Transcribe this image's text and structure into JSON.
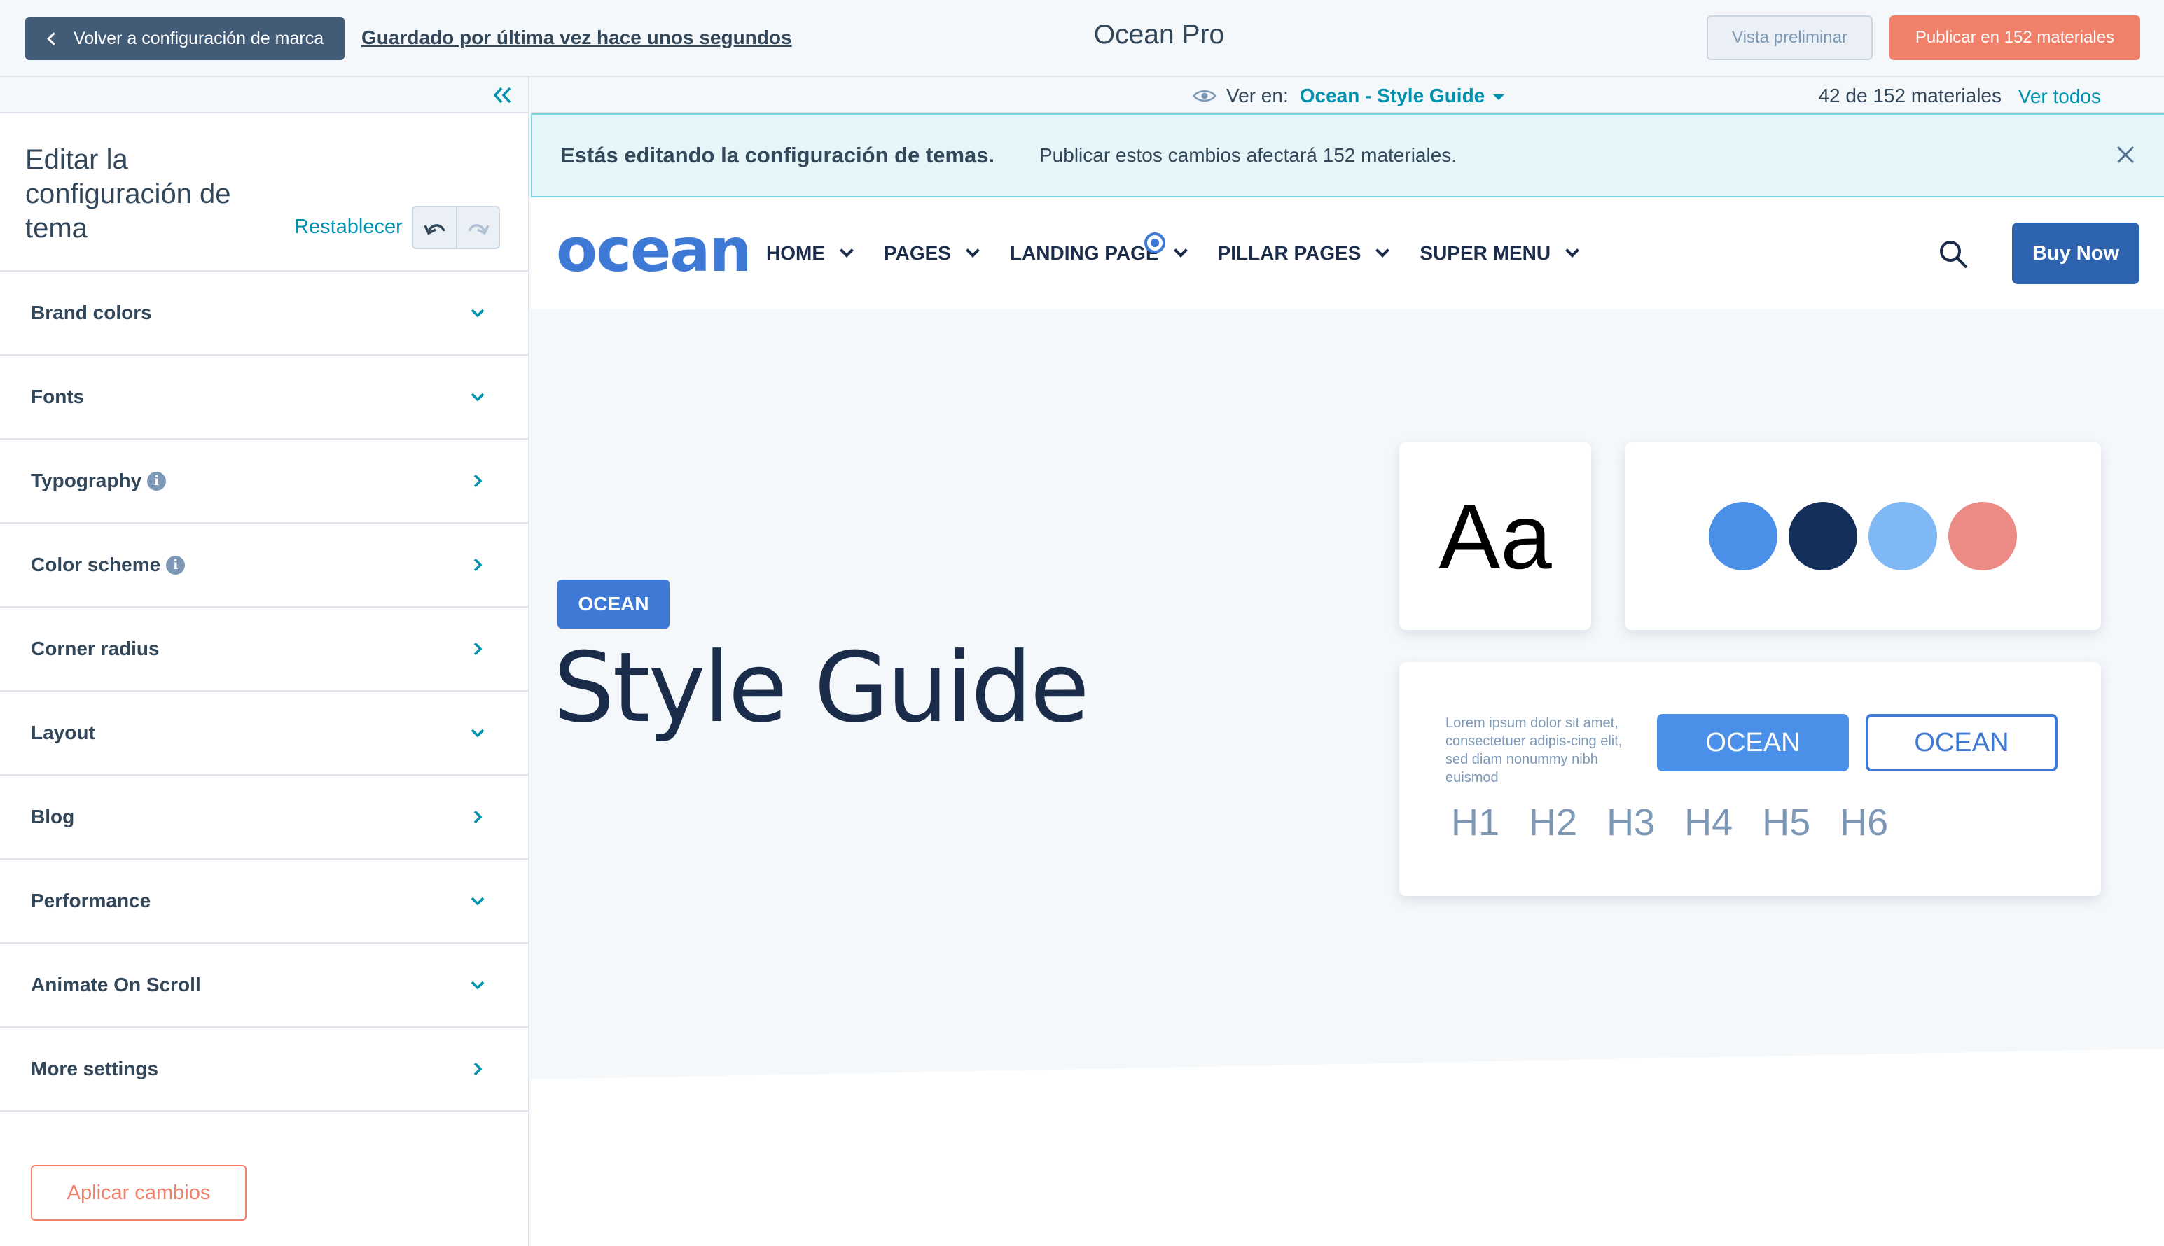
{
  "topbar": {
    "back_label": "Volver a configuración de marca",
    "saved_text": "Guardado por última vez hace unos segundos",
    "title": "Ocean Pro",
    "preview_label": "Vista preliminar",
    "publish_label": "Publicar en 152 materiales"
  },
  "sidebar": {
    "title": "Editar la configuración de tema",
    "reset_label": "Restablecer",
    "items": [
      {
        "label": "Brand colors",
        "chevron": "down",
        "info": false
      },
      {
        "label": "Fonts",
        "chevron": "down",
        "info": false
      },
      {
        "label": "Typography",
        "chevron": "right",
        "info": true
      },
      {
        "label": "Color scheme",
        "chevron": "right",
        "info": true
      },
      {
        "label": "Corner radius",
        "chevron": "right",
        "info": false
      },
      {
        "label": "Layout",
        "chevron": "down",
        "info": false
      },
      {
        "label": "Blog",
        "chevron": "right",
        "info": false
      },
      {
        "label": "Performance",
        "chevron": "down",
        "info": false
      },
      {
        "label": "Animate On Scroll",
        "chevron": "down",
        "info": false
      },
      {
        "label": "More settings",
        "chevron": "right",
        "info": false
      }
    ],
    "apply_label": "Aplicar cambios"
  },
  "viewbar": {
    "view_on_label": "Ver en:",
    "selected_view": "Ocean - Style Guide",
    "count_text": "42 de 152 materiales",
    "view_all_label": "Ver todos"
  },
  "notice": {
    "strong": "Estás editando la configuración de temas.",
    "text": "Publicar estos cambios afectará 152 materiales."
  },
  "site": {
    "logo": "ocean",
    "nav": [
      "HOME",
      "PAGES",
      "LANDING PAGE",
      "PILLAR PAGES",
      "SUPER MENU"
    ],
    "buy_label": "Buy Now",
    "tag": "OCEAN",
    "hero_title": "Style Guide",
    "aa": "Aa",
    "swatches": [
      "#4a8fe8",
      "#14305a",
      "#7fb8f5",
      "#ec8a86"
    ],
    "lorem": "Lorem ipsum dolor sit amet, consectetuer adipis-cing elit, sed diam nonummy nibh euismod",
    "btn_fill": "OCEAN",
    "btn_outline": "OCEAN",
    "headings": [
      "H1",
      "H2",
      "H3",
      "H4",
      "H5",
      "H6"
    ]
  },
  "icons": {
    "back": "chevron-left-icon",
    "collapse": "double-chevron-left-icon",
    "undo": "undo-icon",
    "redo": "redo-icon",
    "eye": "eye-icon",
    "close": "close-icon",
    "search": "search-icon"
  },
  "colors": {
    "accent": "#0091ae",
    "publish": "#f0806a",
    "brand_blue": "#3e79d6"
  }
}
